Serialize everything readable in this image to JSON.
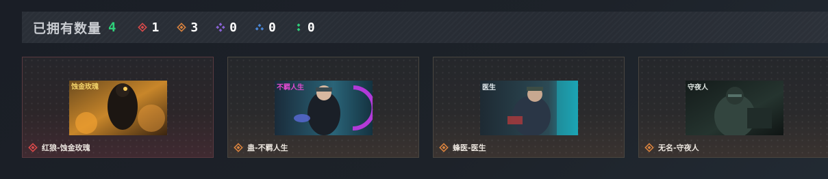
{
  "header": {
    "title": "已拥有数量",
    "count": "4",
    "rarities": [
      {
        "icon": "red-diamond-icon",
        "color": "#d84a4a",
        "value": "1"
      },
      {
        "icon": "orange-diamond-icon",
        "color": "#d8823e",
        "value": "3"
      },
      {
        "icon": "purple-diamond-icon",
        "color": "#8a63d6",
        "value": "0"
      },
      {
        "icon": "blue-diamond-icon",
        "color": "#4a88d8",
        "value": "0"
      },
      {
        "icon": "green-diamond-icon",
        "color": "#2fd07a",
        "value": "0"
      }
    ]
  },
  "cards": [
    {
      "name": "红狼-蚀金玫瑰",
      "rarity_color": "#d84a4a",
      "image_title": "蚀金玫瑰"
    },
    {
      "name": "蛊-不羁人生",
      "rarity_color": "#d8823e",
      "image_title": "不羁人生"
    },
    {
      "name": "蜂医-医生",
      "rarity_color": "#d8823e",
      "image_title": "医生"
    },
    {
      "name": "无名-守夜人",
      "rarity_color": "#d8823e",
      "image_title": "守夜人"
    }
  ]
}
